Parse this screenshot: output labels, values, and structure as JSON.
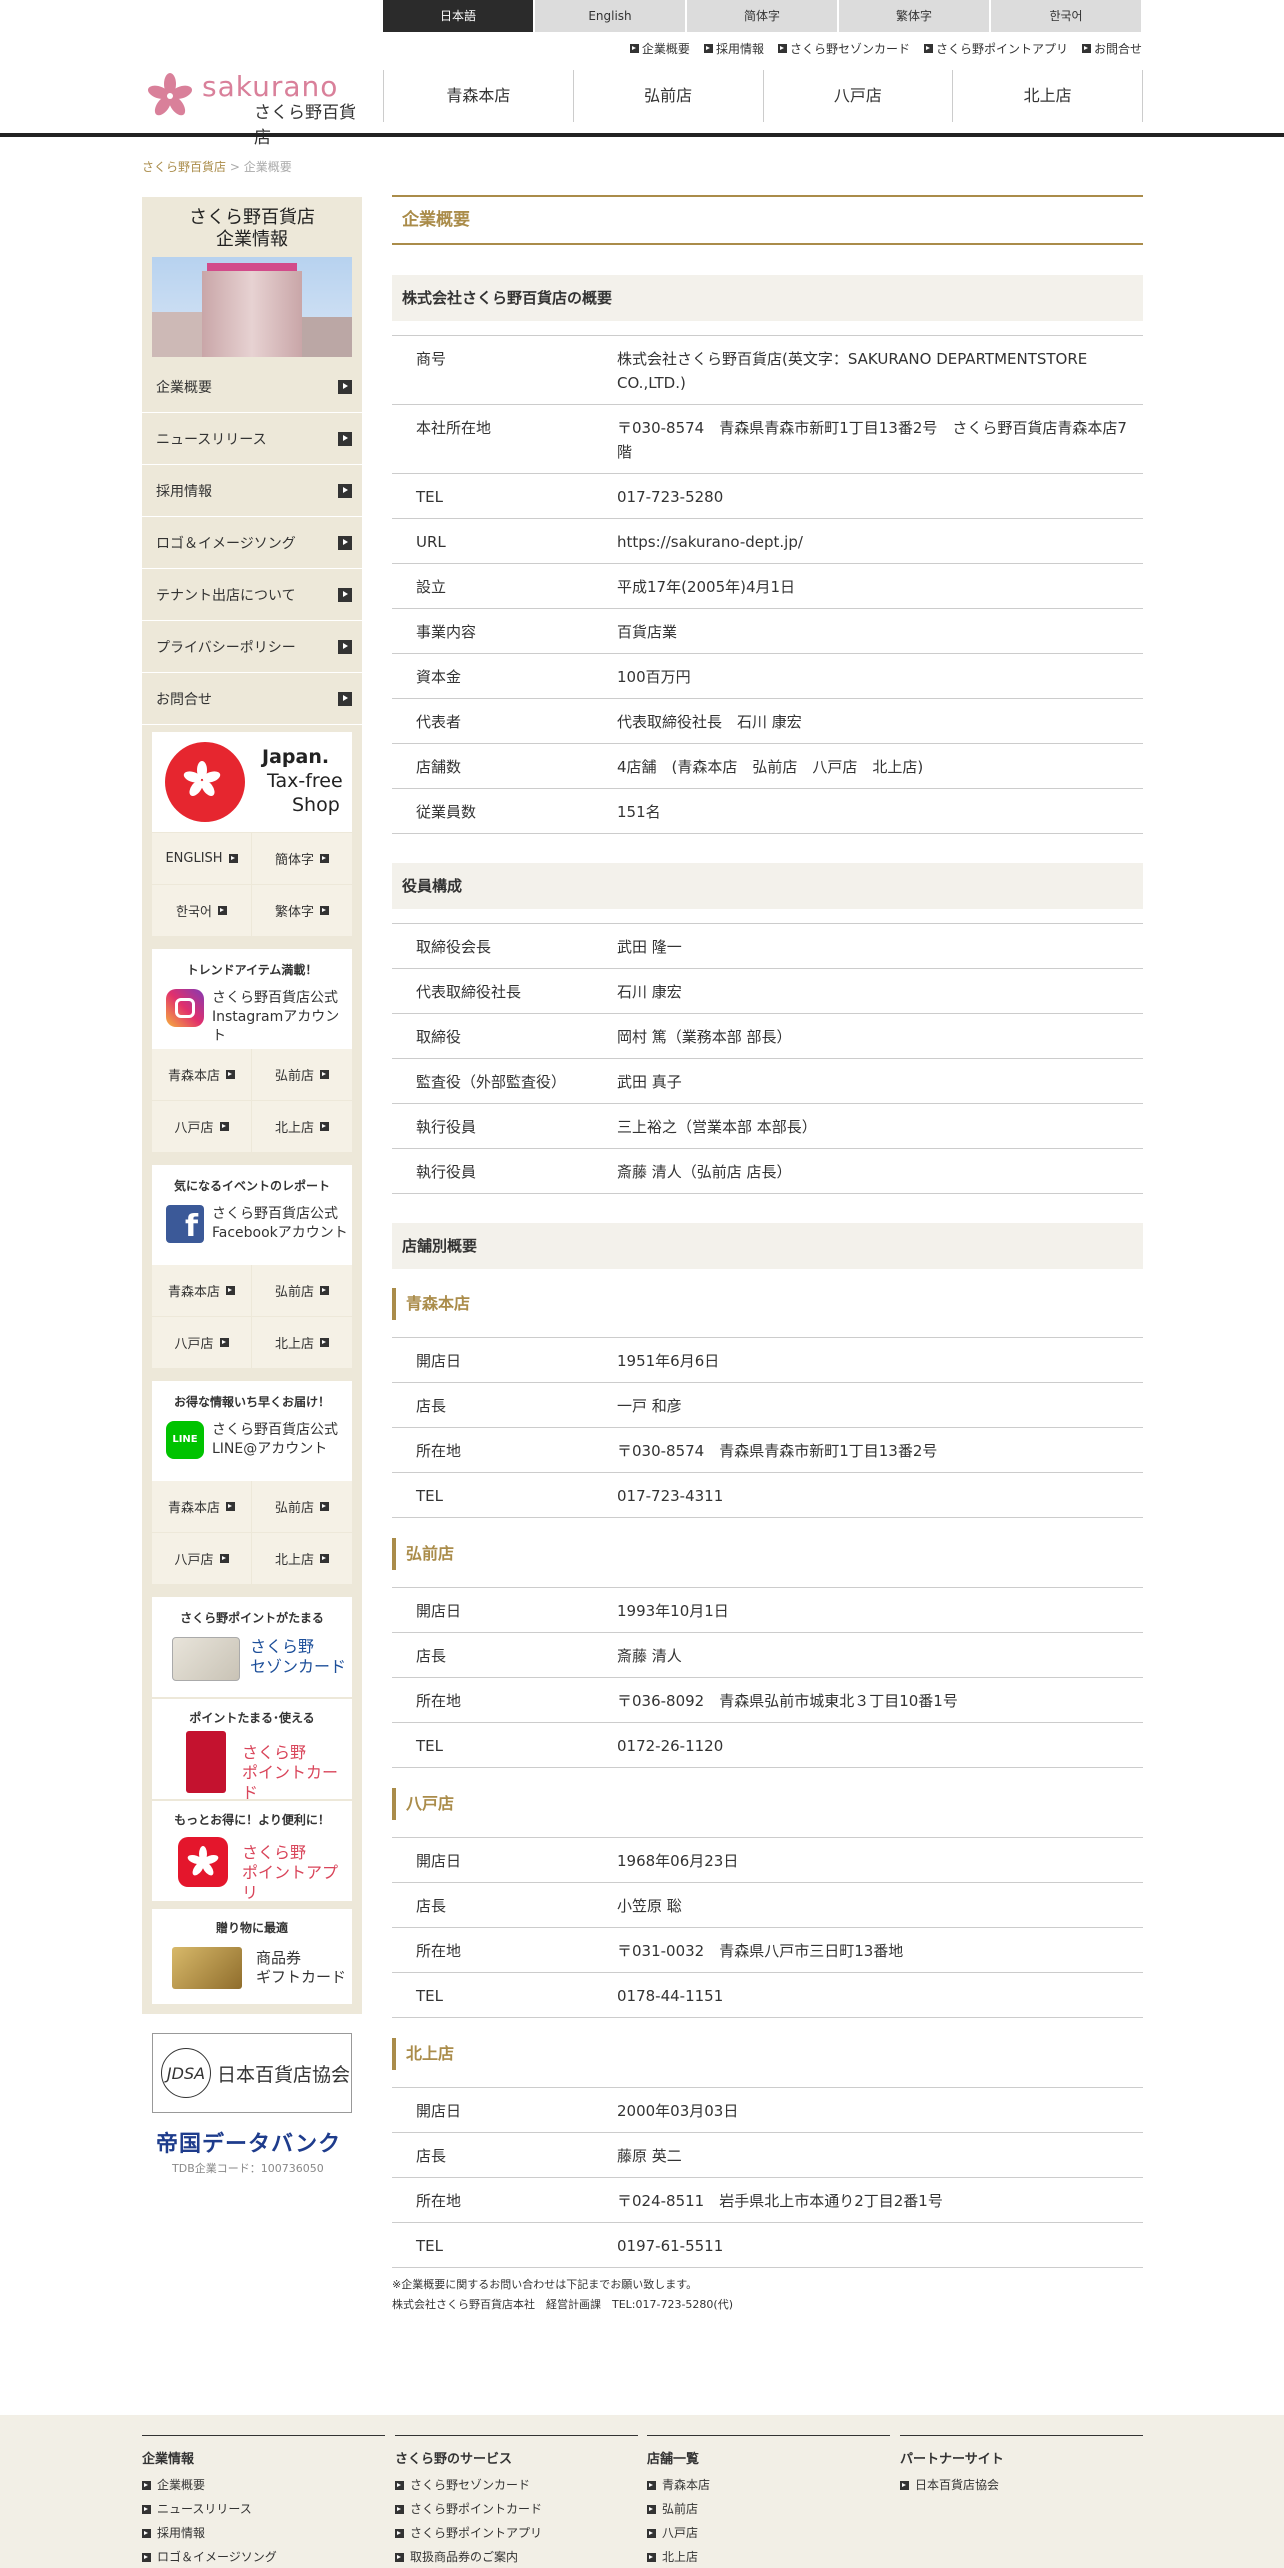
{
  "lang_bar": [
    "日本語",
    "English",
    "简体字",
    "繁体字",
    "한국어"
  ],
  "util_links": [
    "企業概要",
    "採用情報",
    "さくら野セゾンカード",
    "さくら野ポイントアプリ",
    "お問合せ"
  ],
  "logo": {
    "word": "sakurano",
    "jp": "さくら野百貨店"
  },
  "gnav": [
    "青森本店",
    "弘前店",
    "八戸店",
    "北上店"
  ],
  "breadcrumb": {
    "home": "さくら野百貨店",
    "sep": ">",
    "current": "企業概要"
  },
  "sidebar": {
    "title1": "さくら野百貨店",
    "title2": "企業情報",
    "menu": [
      "企業概要",
      "ニュースリリース",
      "採用情報",
      "ロゴ＆イメージソング",
      "テナント出店について",
      "プライバシーポリシー",
      "お問合せ"
    ],
    "taxfree": {
      "l1": "Japan.",
      "l2": "Tax-free",
      "l3": "Shop"
    },
    "lang_grid": [
      "ENGLISH",
      "簡体字",
      "한국어",
      "繁体字"
    ],
    "instagram": {
      "top": "トレンドアイテム満載！",
      "l1": "さくら野百貨店公式",
      "l2": "Instagramアカウント"
    },
    "facebook": {
      "top": "気になるイベントのレポート",
      "l1": "さくら野百貨店公式",
      "l2": "Facebookアカウント"
    },
    "line": {
      "top": "お得な情報いち早くお届け！",
      "l1": "さくら野百貨店公式",
      "l2": "LINE@アカウント"
    },
    "store_grid": [
      "青森本店",
      "弘前店",
      "八戸店",
      "北上店"
    ],
    "saison": {
      "top": "さくら野ポイントがたまる",
      "l1": "さくら野",
      "l2": "セゾンカード"
    },
    "pointcard": {
      "top": "ポイントたまる･使える",
      "l1": "さくら野",
      "l2": "ポイントカード"
    },
    "pointapp": {
      "top": "もっとお得に！より便利に！",
      "l1": "さくら野",
      "l2": "ポイントアプリ"
    },
    "gift": {
      "top": "贈り物に最適",
      "l1": "商品券",
      "l2": "ギフトカード"
    },
    "assoc": "日本百貨店協会",
    "tdb": "帝国データバンク",
    "tdb_code": "TDB企業コード：100736050"
  },
  "main": {
    "title": "企業概要",
    "sec1_title": "株式会社さくら野百貨店の概要",
    "sec1": [
      {
        "k": "商号",
        "v": "株式会社さくら野百貨店(英文字：SAKURANO DEPARTMENTSTORE CO.,LTD.)"
      },
      {
        "k": "本社所在地",
        "v": "〒030-8574　青森県青森市新町1丁目13番2号　さくら野百貨店青森本店7階"
      },
      {
        "k": "TEL",
        "v": "017-723-5280"
      },
      {
        "k": "URL",
        "v": "https://sakurano-dept.jp/"
      },
      {
        "k": "設立",
        "v": "平成17年(2005年)4月1日"
      },
      {
        "k": "事業内容",
        "v": "百貨店業"
      },
      {
        "k": "資本金",
        "v": "100百万円"
      },
      {
        "k": "代表者",
        "v": "代表取締役社長　石川 康宏"
      },
      {
        "k": "店舗数",
        "v": "4店舗　(青森本店　弘前店　八戸店　北上店)"
      },
      {
        "k": "従業員数",
        "v": "151名"
      }
    ],
    "sec2_title": "役員構成",
    "sec2": [
      {
        "k": "取締役会長",
        "v": "武田 隆一"
      },
      {
        "k": "代表取締役社長",
        "v": "石川 康宏"
      },
      {
        "k": "取締役",
        "v": "岡村 篤（業務本部 部長）"
      },
      {
        "k": "監査役（外部監査役）",
        "v": "武田 真子"
      },
      {
        "k": "執行役員",
        "v": "三上裕之（営業本部 本部長）"
      },
      {
        "k": "執行役員",
        "v": "斎藤 清人（弘前店 店長）"
      }
    ],
    "sec3_title": "店舗別概要",
    "stores": [
      {
        "name": "青森本店",
        "rows": [
          {
            "k": "開店日",
            "v": "1951年6月6日"
          },
          {
            "k": "店長",
            "v": "一戸 和彦"
          },
          {
            "k": "所在地",
            "v": "〒030-8574　青森県青森市新町1丁目13番2号"
          },
          {
            "k": "TEL",
            "v": "017-723-4311"
          }
        ]
      },
      {
        "name": "弘前店",
        "rows": [
          {
            "k": "開店日",
            "v": "1993年10月1日"
          },
          {
            "k": "店長",
            "v": "斎藤 清人"
          },
          {
            "k": "所在地",
            "v": "〒036-8092　青森県弘前市城東北３丁目10番1号"
          },
          {
            "k": "TEL",
            "v": "0172-26-1120"
          }
        ]
      },
      {
        "name": "八戸店",
        "rows": [
          {
            "k": "開店日",
            "v": "1968年06月23日"
          },
          {
            "k": "店長",
            "v": "小笠原 聡"
          },
          {
            "k": "所在地",
            "v": "〒031-0032　青森県八戸市三日町13番地"
          },
          {
            "k": "TEL",
            "v": "0178-44-1151"
          }
        ]
      },
      {
        "name": "北上店",
        "rows": [
          {
            "k": "開店日",
            "v": "2000年03月03日"
          },
          {
            "k": "店長",
            "v": "藤原 英二"
          },
          {
            "k": "所在地",
            "v": "〒024-8511　岩手県北上市本通り2丁目2番1号"
          },
          {
            "k": "TEL",
            "v": "0197-61-5511"
          }
        ]
      }
    ],
    "note1": "※企業概要に関するお問い合わせは下記までお願い致します。",
    "note2": "株式会社さくら野百貨店本社　経営計画課　TEL:017-723-5280(代)"
  },
  "footer": [
    {
      "title": "企業情報",
      "items": [
        "企業概要",
        "ニュースリリース",
        "採用情報",
        "ロゴ＆イメージソング"
      ]
    },
    {
      "title": "さくら野のサービス",
      "items": [
        "さくら野セゾンカード",
        "さくら野ポイントカード",
        "さくら野ポイントアプリ",
        "取扱商品券のご案内"
      ]
    },
    {
      "title": "店舗一覧",
      "items": [
        "青森本店",
        "弘前店",
        "八戸店",
        "北上店"
      ]
    },
    {
      "title": "パートナーサイト",
      "items": [
        "日本百貨店協会"
      ]
    }
  ],
  "colors": {
    "accent": "#aa8c4a",
    "sakura": "#d9809a",
    "sidebar_bg": "#ede8d9"
  }
}
